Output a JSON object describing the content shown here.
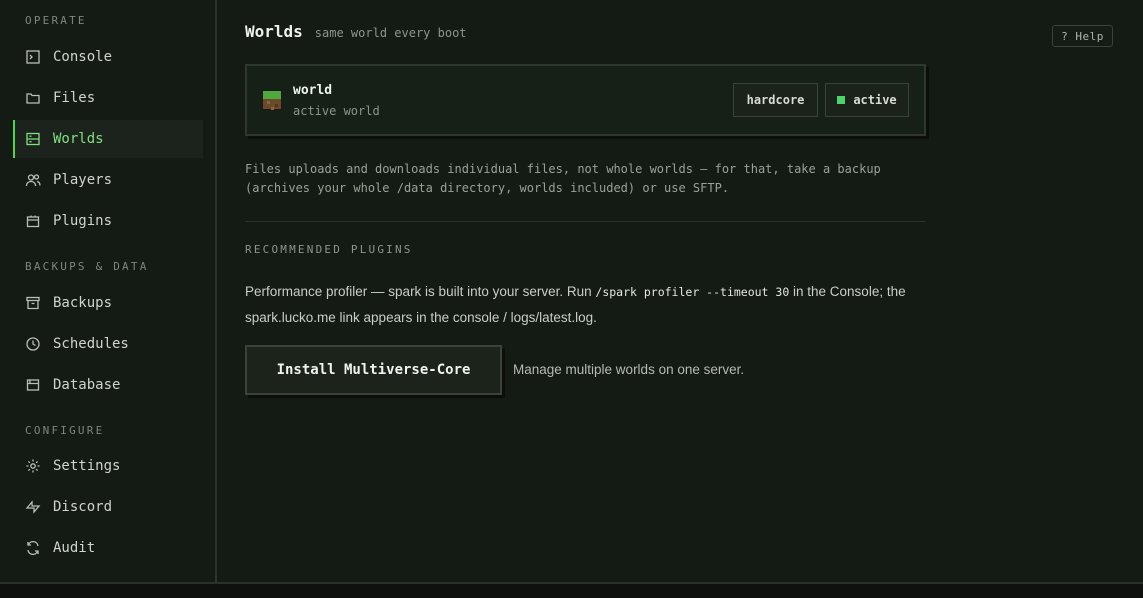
{
  "sidebar": {
    "sections": [
      {
        "title": "OPERATE",
        "items": [
          {
            "label": "Console",
            "icon": "console-icon"
          },
          {
            "label": "Files",
            "icon": "folder-icon"
          },
          {
            "label": "Worlds",
            "icon": "server-icon",
            "active": true
          },
          {
            "label": "Players",
            "icon": "users-icon"
          },
          {
            "label": "Plugins",
            "icon": "plugin-icon"
          }
        ]
      },
      {
        "title": "BACKUPS & DATA",
        "items": [
          {
            "label": "Backups",
            "icon": "archive-icon"
          },
          {
            "label": "Schedules",
            "icon": "clock-icon"
          },
          {
            "label": "Database",
            "icon": "database-icon"
          }
        ]
      },
      {
        "title": "CONFIGURE",
        "items": [
          {
            "label": "Settings",
            "icon": "gear-icon"
          },
          {
            "label": "Discord",
            "icon": "discord-icon"
          },
          {
            "label": "Audit",
            "icon": "audit-icon"
          }
        ]
      }
    ]
  },
  "header": {
    "title": "Worlds",
    "subtitle": "same world every boot",
    "help_label": "? Help"
  },
  "world": {
    "name": "world",
    "status_text": "active world",
    "mode_badge": "hardcore",
    "state_badge": "active"
  },
  "note": "Files uploads and downloads individual files, not whole worlds — for that, take a backup (archives your whole /data directory, worlds included) or use SFTP.",
  "recommended": {
    "title": "RECOMMENDED PLUGINS",
    "perf_prefix": "Performance profiler — spark is built into your server. Run ",
    "perf_command": "/spark profiler --timeout 30",
    "perf_suffix": " in the Console; the spark.lucko.me link appears in the console / logs/latest.log.",
    "install_label": "Install Multiverse-Core",
    "install_desc": "Manage multiple worlds on one server."
  },
  "colors": {
    "accent": "#4cd74c",
    "background": "#141a14",
    "active_dot": "#4ed26b"
  }
}
